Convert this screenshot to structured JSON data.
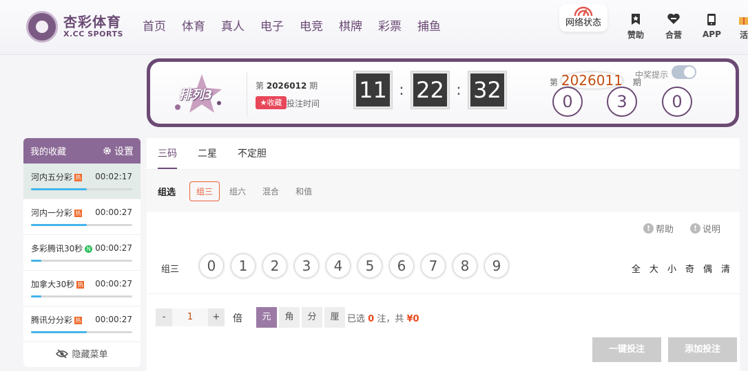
{
  "header": {
    "logo_cn": "杏彩体育",
    "logo_en": "X.CC SPORTS",
    "nav": [
      "首页",
      "体育",
      "真人",
      "电子",
      "电竞",
      "棋牌",
      "彩票",
      "捕鱼"
    ],
    "network_status": "网络状态",
    "sponsor": "赞助",
    "partner": "合营",
    "app": "APP",
    "activity": "活"
  },
  "banner": {
    "lottery_name": "排列3",
    "current_issue_prefix": "第",
    "current_issue": "2026012",
    "current_issue_suffix": "期",
    "favorite_label": "收藏",
    "bet_time_label": "投注时间",
    "timer": [
      "11",
      "22",
      "32"
    ],
    "prev_issue_prefix": "第",
    "prev_issue": "2026011",
    "prev_issue_suffix": "期",
    "prize_tip": "中奖提示",
    "prev_result": [
      "0",
      "3",
      "0"
    ]
  },
  "favorites": {
    "title": "我的收藏",
    "settings": "设置",
    "items": [
      {
        "name": "河内五分彩",
        "badge": "热",
        "time": "00:02:17",
        "progress": 0.55
      },
      {
        "name": "河内一分彩",
        "badge": "热",
        "time": "00:00:27",
        "progress": 0.55
      },
      {
        "name": "多彩腾讯30秒",
        "badge": "N",
        "time": "00:00:27",
        "progress": 0.1
      },
      {
        "name": "加拿大30秒",
        "badge": "热",
        "time": "00:00:27",
        "progress": 0.1
      },
      {
        "name": "腾讯分分彩",
        "badge": "热",
        "time": "00:00:27",
        "progress": 0.55
      }
    ],
    "hide_menu": "隐藏菜单"
  },
  "play": {
    "tabs": [
      "三码",
      "二星",
      "不定胆"
    ],
    "sub_label": "组选",
    "subtabs": [
      "组三",
      "组六",
      "混合",
      "和值"
    ],
    "help": "帮助",
    "explain": "说明",
    "pick_label": "组三",
    "numbers": [
      "0",
      "1",
      "2",
      "3",
      "4",
      "5",
      "6",
      "7",
      "8",
      "9"
    ],
    "quick": [
      "全",
      "大",
      "小",
      "奇",
      "偶",
      "清"
    ],
    "minus": "-",
    "multiplier": "1",
    "plus": "+",
    "bei": "倍",
    "units": [
      "元",
      "角",
      "分",
      "厘"
    ],
    "selected_prefix": "已选",
    "selected_count": "0",
    "selected_mid": "注，共",
    "amount": "¥0",
    "one_click_bet": "一键投注",
    "add_bet": "添加投注"
  }
}
